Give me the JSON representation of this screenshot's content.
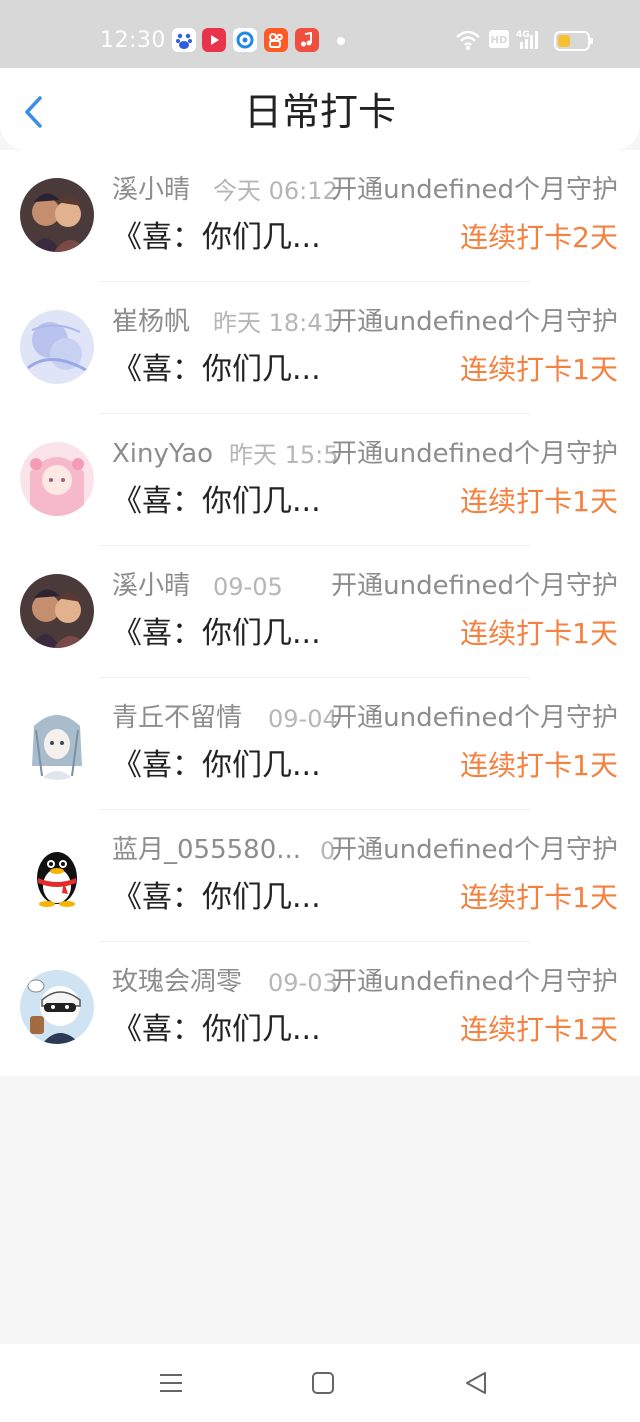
{
  "status_bar": {
    "time": "12:30",
    "apps": [
      "baidu-icon",
      "video-icon",
      "browser-icon",
      "kuaishou-icon",
      "music-icon"
    ],
    "system_icons": [
      "wifi-icon",
      "hd-icon",
      "signal-4g-icon",
      "battery-icon"
    ]
  },
  "header": {
    "title": "日常打卡",
    "back_icon": "chevron-left-icon"
  },
  "colors": {
    "accent_blue": "#3a8ee6",
    "streak_orange": "#f4813f"
  },
  "checkins": [
    {
      "name": "溪小晴",
      "date": "今天 06:12",
      "guard": "开通undefined个月守护",
      "message": "《喜：你们几...",
      "streak": "连续打卡2天",
      "avatar": "anime-couple-avatar"
    },
    {
      "name": "崔杨帆",
      "date": "昨天 18:41",
      "guard": "开通undefined个月守护",
      "message": "《喜：你们几...",
      "streak": "连续打卡1天",
      "avatar": "blue-watercolor-avatar"
    },
    {
      "name": "XinyYao",
      "date": "昨天 15:5",
      "guard": "开通undefined个月守护",
      "message": "《喜：你们几...",
      "streak": "连续打卡1天",
      "avatar": "pink-anime-girl-avatar"
    },
    {
      "name": "溪小晴",
      "date": "09-05",
      "guard": "开通undefined个月守护",
      "message": "《喜：你们几...",
      "streak": "连续打卡1天",
      "avatar": "anime-couple-avatar"
    },
    {
      "name": "青丘不留情",
      "date": "09-04",
      "guard": "开通undefined个月守护",
      "message": "《喜：你们几...",
      "streak": "连续打卡1天",
      "avatar": "sketch-girl-avatar"
    },
    {
      "name": "蓝月_055580...",
      "date": "0",
      "guard": "开通undefined个月守护",
      "message": "《喜：你们几...",
      "streak": "连续打卡1天",
      "avatar": "qq-penguin-avatar"
    },
    {
      "name": "玫瑰会凋零",
      "date": "09-03",
      "guard": "开通undefined个月守护",
      "message": "《喜：你们几...",
      "streak": "连续打卡1天",
      "avatar": "masked-cartoon-avatar"
    }
  ],
  "nav_bar": {
    "buttons": [
      "menu-icon",
      "home-square-icon",
      "back-triangle-icon"
    ]
  }
}
